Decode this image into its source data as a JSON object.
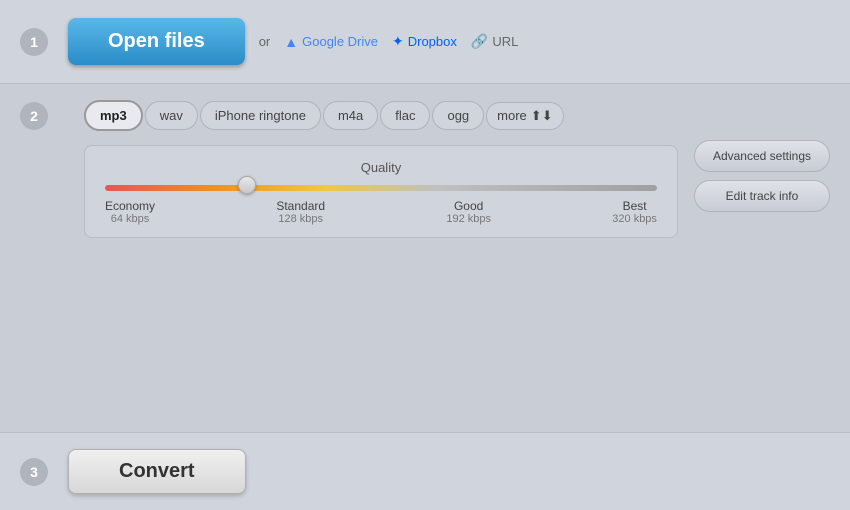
{
  "step1": {
    "badge": "1",
    "open_files_label": "Open files",
    "or_text": "or",
    "google_drive_label": "Google Drive",
    "dropbox_label": "Dropbox",
    "url_label": "URL"
  },
  "step2": {
    "badge": "2",
    "tabs": [
      {
        "label": "mp3",
        "active": true
      },
      {
        "label": "wav",
        "active": false
      },
      {
        "label": "iPhone ringtone",
        "active": false
      },
      {
        "label": "m4a",
        "active": false
      },
      {
        "label": "flac",
        "active": false
      },
      {
        "label": "ogg",
        "active": false
      }
    ],
    "more_label": "more",
    "quality": {
      "title": "Quality",
      "slider_value": "25",
      "labels": [
        {
          "name": "Economy",
          "kbps": "64 kbps"
        },
        {
          "name": "Standard",
          "kbps": "128 kbps"
        },
        {
          "name": "Good",
          "kbps": "192 kbps"
        },
        {
          "name": "Best",
          "kbps": "320 kbps"
        }
      ]
    },
    "advanced_settings_label": "Advanced settings",
    "edit_track_info_label": "Edit track info"
  },
  "step3": {
    "badge": "3",
    "convert_label": "Convert"
  }
}
